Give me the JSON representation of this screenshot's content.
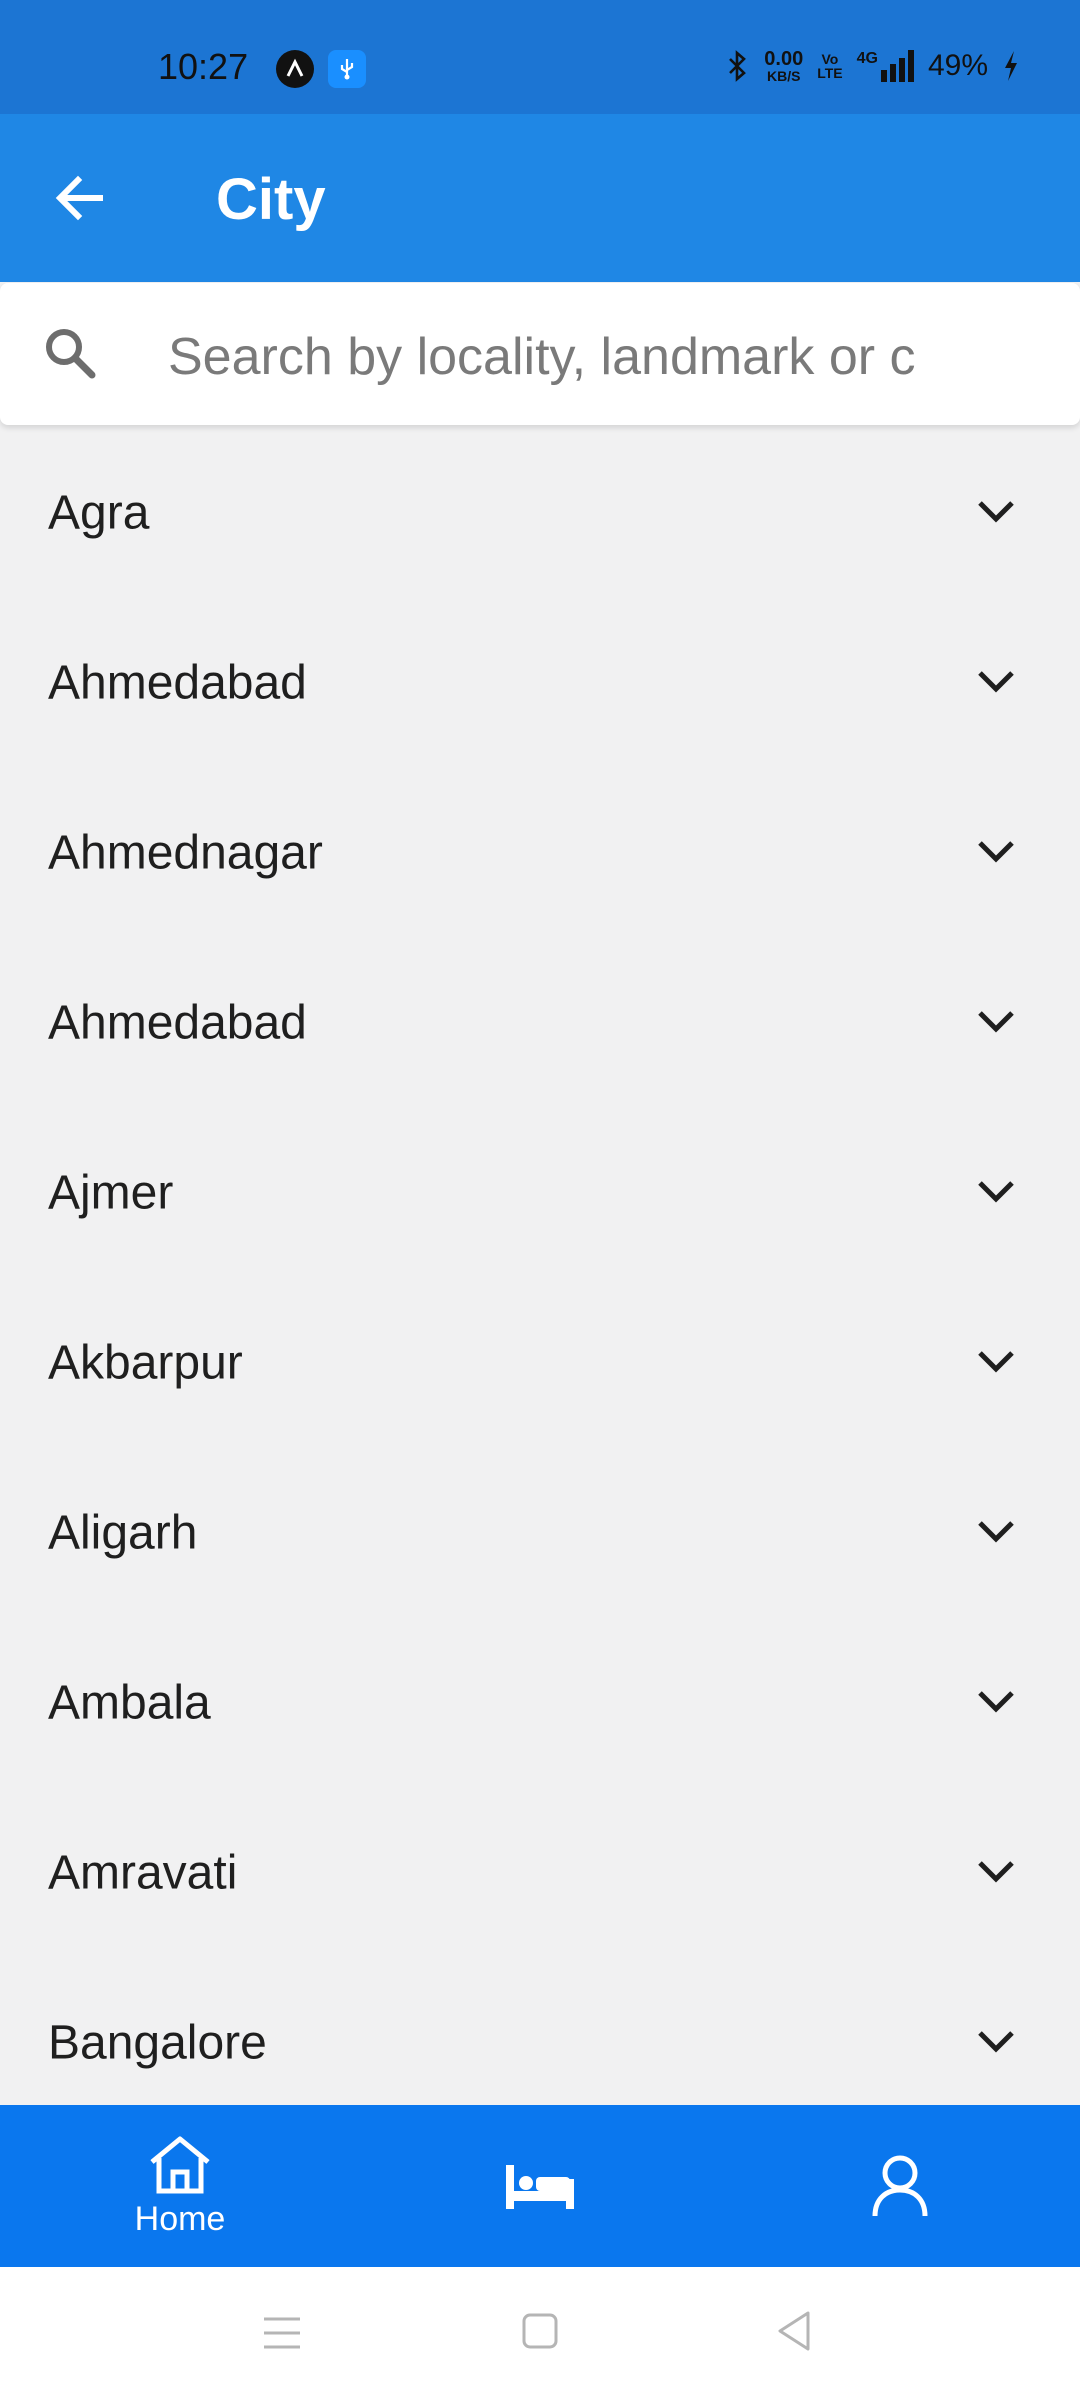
{
  "status_bar": {
    "time": "10:27",
    "speed_value": "0.00",
    "speed_unit": "KB/S",
    "volte_top": "Vo",
    "volte_bottom": "LTE",
    "network": "4G",
    "battery": "49%",
    "icons": [
      "app-notification-icon",
      "usb-icon",
      "bluetooth-icon",
      "signal-icon",
      "charging-icon"
    ]
  },
  "app_bar": {
    "title": "City",
    "back_icon": "arrow-left-icon"
  },
  "search": {
    "placeholder": "Search by locality, landmark or c",
    "icon": "search-icon"
  },
  "cities": [
    {
      "name": "Agra"
    },
    {
      "name": "Ahmedabad"
    },
    {
      "name": "Ahmednagar"
    },
    {
      "name": "Ahmedabad"
    },
    {
      "name": "Ajmer"
    },
    {
      "name": "Akbarpur"
    },
    {
      "name": "Aligarh"
    },
    {
      "name": "Ambala"
    },
    {
      "name": "Amravati"
    },
    {
      "name": "Bangalore"
    }
  ],
  "bottom_nav": {
    "items": [
      {
        "label": "Home",
        "icon": "home-icon",
        "active": true
      },
      {
        "label": "",
        "icon": "bed-icon",
        "active": false
      },
      {
        "label": "",
        "icon": "profile-icon",
        "active": false
      }
    ]
  },
  "colors": {
    "status_bar": "#1c75d3",
    "app_bar": "#1f87e5",
    "bottom_nav": "#0a77ee",
    "list_bg": "#f1f1f2"
  }
}
